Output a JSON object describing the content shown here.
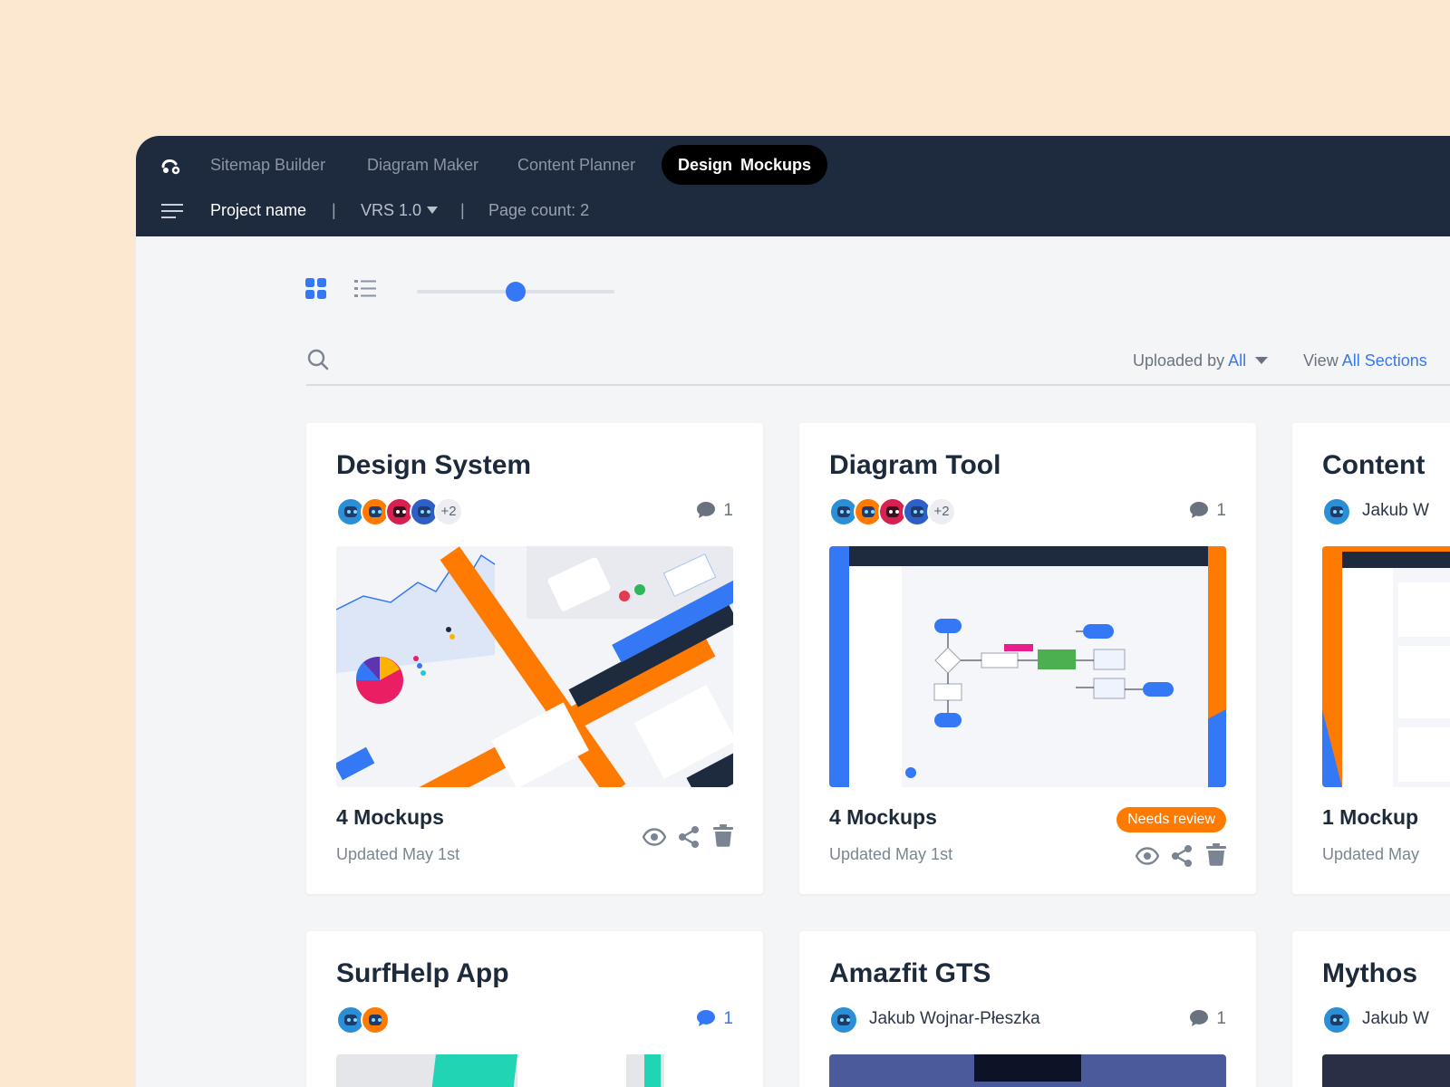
{
  "nav": {
    "tabs": [
      {
        "label": "Sitemap Builder"
      },
      {
        "label": "Diagram Maker"
      },
      {
        "label": "Content Planner"
      },
      {
        "label": "Design  Mockups"
      }
    ],
    "active_tab_index": 3
  },
  "project": {
    "name": "Project name",
    "separator": "|",
    "version": "VRS 1.0",
    "page_count": "Page count: 2"
  },
  "view": {
    "mode": "grid",
    "zoom_fraction": 0.5
  },
  "filters": {
    "uploaded_by_label": "Uploaded by",
    "uploaded_by_value": "All",
    "view_label": "View",
    "view_value": "All Sections"
  },
  "colors": {
    "topbar": "#1e2a3d",
    "accent": "#3478f6",
    "orange": "#ff7a00",
    "page_bg": "#fce7d0"
  },
  "cards": [
    {
      "title": "Design System",
      "avatar_more": "+2",
      "comments": "1",
      "mockups": "4 Mockups",
      "updated": "Updated May 1st"
    },
    {
      "title": "Diagram Tool",
      "avatar_more": "+2",
      "comments": "1",
      "mockups": "4 Mockups",
      "updated": "Updated May 1st",
      "badge": "Needs review"
    },
    {
      "title": "Content",
      "author": "Jakub W",
      "mockups": "1 Mockup",
      "updated": "Updated May"
    },
    {
      "title": "SurfHelp App",
      "comments": "1"
    },
    {
      "title": "Amazfit GTS",
      "author": "Jakub Wojnar-Płeszka",
      "comments": "1"
    },
    {
      "title": "Mythos",
      "author": "Jakub W"
    }
  ],
  "icons": {
    "comment": "chat-bubble-icon",
    "view": "eye-icon",
    "share": "share-icon",
    "delete": "trash-icon"
  }
}
